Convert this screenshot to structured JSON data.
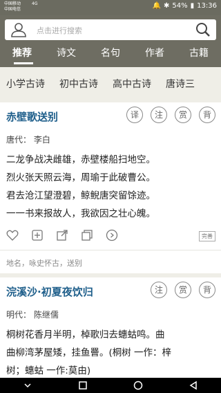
{
  "status": {
    "carrier1": "中国移动",
    "carrier2": "中国电信",
    "network": "4G",
    "battery": "54%",
    "time": "13:36"
  },
  "search": {
    "placeholder": "点击进行搜索"
  },
  "tabs": [
    {
      "label": "推荐"
    },
    {
      "label": "诗文"
    },
    {
      "label": "名句"
    },
    {
      "label": "作者"
    },
    {
      "label": "古籍"
    }
  ],
  "subtabs": [
    {
      "label": "小学古诗"
    },
    {
      "label": "初中古诗"
    },
    {
      "label": "高中古诗"
    },
    {
      "label": "唐诗三"
    }
  ],
  "badges": [
    "译",
    "注",
    "赏",
    "背"
  ],
  "cards": [
    {
      "title": "赤壁歌送别",
      "dynasty": "唐代：  李白",
      "lines": [
        "二龙争战决雌雄，赤壁楼船扫地空。",
        "烈火张天照云海，周瑜于此破曹公。",
        "君去沧江望澄碧，鲸鲵唐突留馀迹。",
        "一一书来报故人，我欲因之壮心魄。"
      ],
      "complete": "完善",
      "tags": "地名，咏史怀古，送别"
    },
    {
      "title": "浣溪沙·初夏夜饮归",
      "dynasty": "明代：  陈继儒",
      "lines": [
        "桐树花香月半明，棹歌归去蟪蛄鸣。曲",
        "曲柳湾茅屋矮，挂鱼罾。(桐树 一作：梓",
        "树；蟪蛄 一作:莫由)"
      ]
    }
  ],
  "colors": {
    "header": "#6e6d62",
    "title": "#1f5f8b",
    "background": "#efeee7"
  }
}
